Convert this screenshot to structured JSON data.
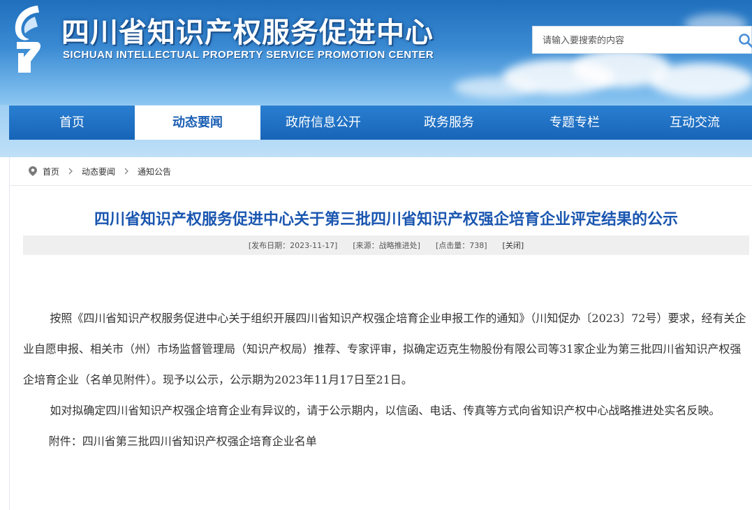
{
  "header": {
    "title": "四川省知识产权服务促进中心",
    "subtitle": "SICHUAN INTELLECTUAL PROPERTY SERVICE PROMOTION CENTER",
    "logo_icon": "sichuan-ip-logo-icon"
  },
  "search": {
    "placeholder": "请输入要搜索的内容",
    "value": "",
    "icon": "search-icon"
  },
  "nav": {
    "items": [
      {
        "label": "首页",
        "active": false
      },
      {
        "label": "动态要闻",
        "active": true
      },
      {
        "label": "政府信息公开",
        "active": false
      },
      {
        "label": "政务服务",
        "active": false
      },
      {
        "label": "专题专栏",
        "active": false
      },
      {
        "label": "互动交流",
        "active": false
      }
    ]
  },
  "breadcrumb": {
    "icon": "location-pin-icon",
    "items": [
      "首页",
      "动态要闻",
      "通知公告"
    ]
  },
  "article": {
    "title": "四川省知识产权服务促进中心关于第三批四川省知识产权强企培育企业评定结果的公示",
    "meta": {
      "date": "[发布日期：2023-11-17]",
      "source": "[来源：战略推进处]",
      "clicks": "[点击量：738]",
      "close": "[关闭]"
    },
    "paragraphs": [
      "按照《四川省知识产权服务促进中心关于组织开展四川省知识产权强企培育企业申报工作的通知》（川知促办〔2023〕72号）要求，经有关企业自愿申报、相关市（州）市场监督管理局（知识产权局）推荐、专家评审，拟确定迈克生物股份有限公司等31家企业为第三批四川省知识产权强企培育企业（名单见附件）。现予以公示，公示期为2023年11月17日至21日。",
      "如对拟确定四川省知识产权强企培育企业有异议的，请于公示期内，以信函、电话、传真等方式向省知识产权中心战略推进处实名反映。"
    ],
    "attachment": "附件：四川省第三批四川省知识产权强企培育企业名单"
  },
  "colors": {
    "nav_bg": "#1a6cc4",
    "title_blue": "#1a56b0",
    "nav_active_text": "#1a5fb4"
  }
}
